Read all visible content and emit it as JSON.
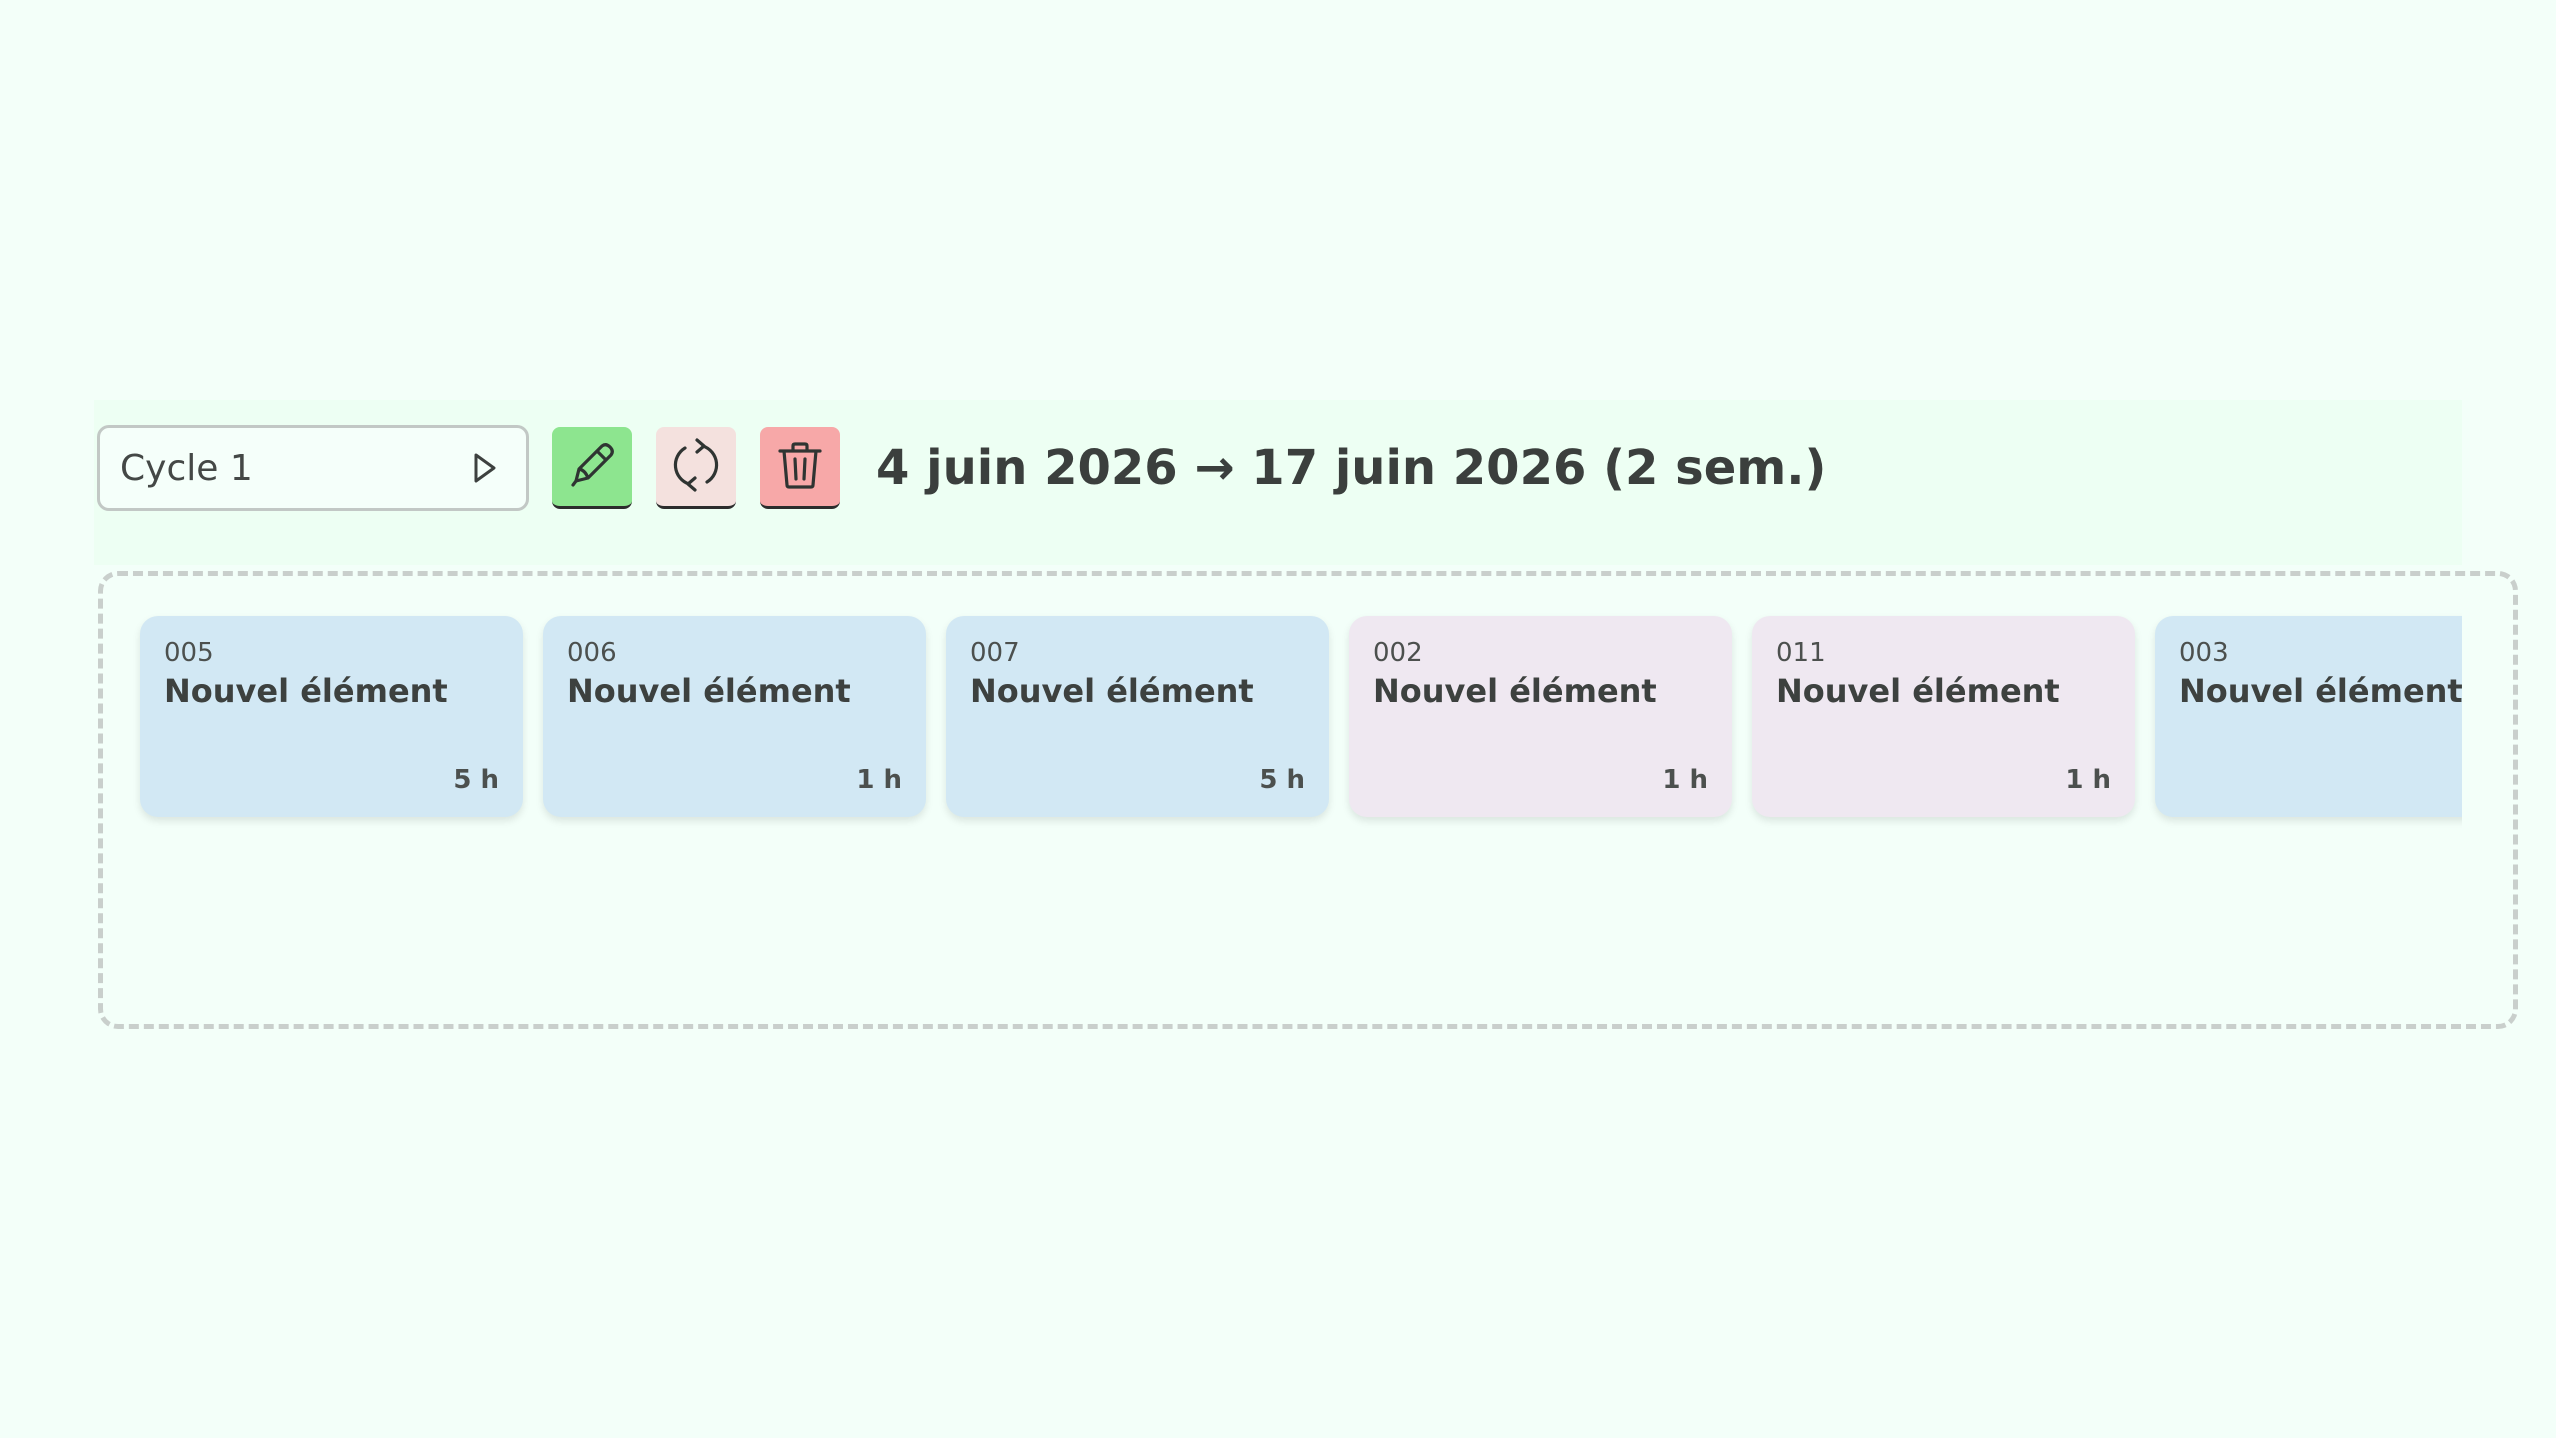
{
  "colors": {
    "page_background": "#f3fff9",
    "toolbar_band": "#edfff3",
    "edit_button": "#8de58f",
    "sync_button": "#f4e1de",
    "delete_button": "#f7a8a8",
    "card_blue": "#d2e8f4",
    "card_lilac": "#efe8f1"
  },
  "toolbar": {
    "cycle_select": {
      "value": "Cycle 1",
      "icon": "play-triangle-icon"
    },
    "edit_button": {
      "icon": "pencil-icon"
    },
    "sync_button": {
      "icon": "refresh-icon"
    },
    "delete_button": {
      "icon": "trash-icon"
    },
    "date_range": "4 juin 2026 → 17 juin 2026 (2 sem.)"
  },
  "cards": [
    {
      "id": "005",
      "title": "Nouvel élément",
      "hours": "5 h",
      "color": "blue"
    },
    {
      "id": "006",
      "title": "Nouvel élément",
      "hours": "1 h",
      "color": "blue"
    },
    {
      "id": "007",
      "title": "Nouvel élément",
      "hours": "5 h",
      "color": "blue"
    },
    {
      "id": "002",
      "title": "Nouvel élément",
      "hours": "1 h",
      "color": "lilac"
    },
    {
      "id": "011",
      "title": "Nouvel élément",
      "hours": "1 h",
      "color": "lilac"
    },
    {
      "id": "003",
      "title": "Nouvel élément",
      "hours": "",
      "color": "blue"
    }
  ]
}
